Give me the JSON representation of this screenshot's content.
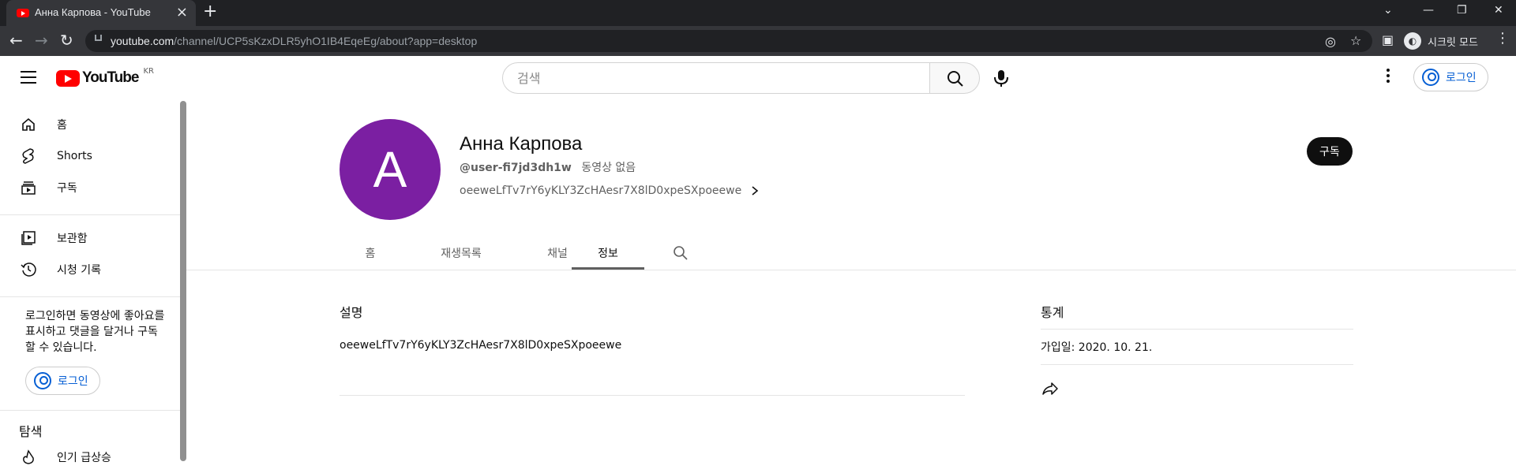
{
  "browser": {
    "tab_title": "Анна Карпова - YouTube",
    "url_domain": "youtube.com",
    "url_path": "/channel/UCP5sKzxDLR5yhO1IB4EqeEg/about?app=desktop",
    "profile_label": "시크릿 모드"
  },
  "masthead": {
    "logo_text": "YouTube",
    "region": "KR",
    "search_placeholder": "검색",
    "signin_label": "로그인"
  },
  "sidebar": {
    "items": [
      {
        "label": "홈",
        "icon": "home-icon"
      },
      {
        "label": "Shorts",
        "icon": "shorts-icon"
      },
      {
        "label": "구독",
        "icon": "subscriptions-icon"
      },
      {
        "label": "보관함",
        "icon": "library-icon"
      },
      {
        "label": "시청 기록",
        "icon": "history-icon"
      }
    ],
    "signin_message": "로그인하면 동영상에 좋아요를 표시하고 댓글을 달거나 구독할 수 있습니다.",
    "signin_label": "로그인",
    "explore_heading": "탐색",
    "explore_first": "인기 급상승"
  },
  "channel": {
    "avatar_letter": "A",
    "avatar_color": "#7b1fa2",
    "name": "Анна Карпова",
    "handle": "@user-fi7jd3dh1w",
    "video_count": "동영상 없음",
    "description_preview": "oeeweLfTv7rY6yKLY3ZcHAesr7X8lD0xpeSXpoeewe",
    "subscribe_label": "구독"
  },
  "tabs": [
    {
      "label": "홈"
    },
    {
      "label": "재생목록"
    },
    {
      "label": "채널"
    },
    {
      "label": "정보",
      "active": true
    }
  ],
  "about": {
    "description_title": "설명",
    "description": "oeeweLfTv7rY6yKLY3ZcHAesr7X8lD0xpeSXpoeewe",
    "stats_title": "통계",
    "joined": "가입일: 2020. 10. 21."
  }
}
